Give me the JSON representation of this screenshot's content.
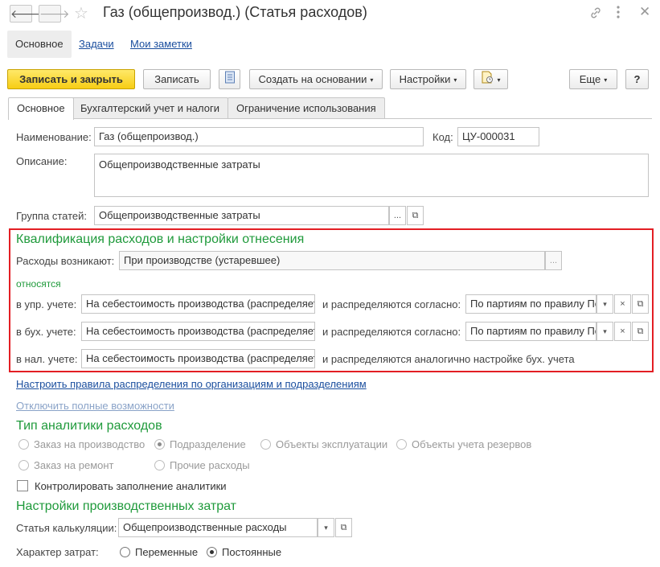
{
  "window": {
    "title": "Газ (общепроизвод.) (Статья расходов)",
    "back_icon": "arrow-left",
    "forward_icon": "arrow-right",
    "star_icon": "star",
    "link_icon": "chain-link",
    "menu_icon": "kebab-menu",
    "close_icon": "close-x"
  },
  "subtabs": {
    "main": "Основное",
    "tasks": "Задачи",
    "notes": "Мои заметки"
  },
  "toolbar": {
    "save_close": "Записать и закрыть",
    "save": "Записать",
    "create_based": "Создать на основании",
    "settings": "Настройки",
    "more": "Еще",
    "help": "?",
    "caret": "▾"
  },
  "tabs": {
    "main": "Основное",
    "accounting": "Бухгалтерский учет и налоги",
    "restriction": "Ограничение использования"
  },
  "form": {
    "name_label": "Наименование:",
    "name_value": "Газ (общепроизвод.)",
    "code_label": "Код:",
    "code_value": "ЦУ-000031",
    "description_label": "Описание:",
    "description_value": "Общепроизводственные затраты",
    "group_label": "Группа статей:",
    "group_value": "Общепроизводственные затраты",
    "ellipsis": "...",
    "open_glyph": "⧉",
    "clear_glyph": "×"
  },
  "qualification": {
    "heading": "Квалификация расходов и настройки отнесения",
    "arise_label": "Расходы возникают:",
    "arise_value": "При производстве (устаревшее)",
    "relate_label": "относятся",
    "mgmt_label": "в упр. учете:",
    "mgmt_value": "На себестоимость производства (распределяется)",
    "mgmt_dist_label": "и распределяются согласно:",
    "mgmt_dist_value": "По партиям по правилу По распределению",
    "acct_label": "в бух. учете:",
    "acct_value": "На себестоимость производства (распределяется)",
    "acct_dist_label": "и распределяются согласно:",
    "acct_dist_value": "По партиям по правилу По распределению",
    "tax_label": "в нал. учете:",
    "tax_value": "На себестоимость производства (распределяется)",
    "tax_dist_text": "и распределяются аналогично настройке бух. учета"
  },
  "links": {
    "configure_rules": "Настроить правила распределения по организациям и подразделениям",
    "disable_full": "Отключить полные возможности"
  },
  "analytics": {
    "heading": "Тип аналитики расходов",
    "options": [
      {
        "label": "Заказ на производство",
        "selected": false
      },
      {
        "label": "Подразделение",
        "selected": true
      },
      {
        "label": "Объекты эксплуатации",
        "selected": false
      },
      {
        "label": "Объекты учета резервов",
        "selected": false
      },
      {
        "label": "Заказ на ремонт",
        "selected": false
      },
      {
        "label": "Прочие расходы",
        "selected": false
      }
    ],
    "control_label": "Контролировать заполнение аналитики",
    "control_checked": false
  },
  "production": {
    "heading": "Настройки производственных затрат",
    "calc_label": "Статья калькуляции:",
    "calc_value": "Общепроизводственные расходы",
    "nature_label": "Характер затрат:",
    "variable_label": "Переменные",
    "constant_label": "Постоянные",
    "selected": "Постоянные"
  },
  "colors": {
    "accent_green": "#1f9a3b",
    "link_blue": "#1a4e9e",
    "primary_yellow": "#f7cd14",
    "highlight_red": "#e31e24"
  }
}
